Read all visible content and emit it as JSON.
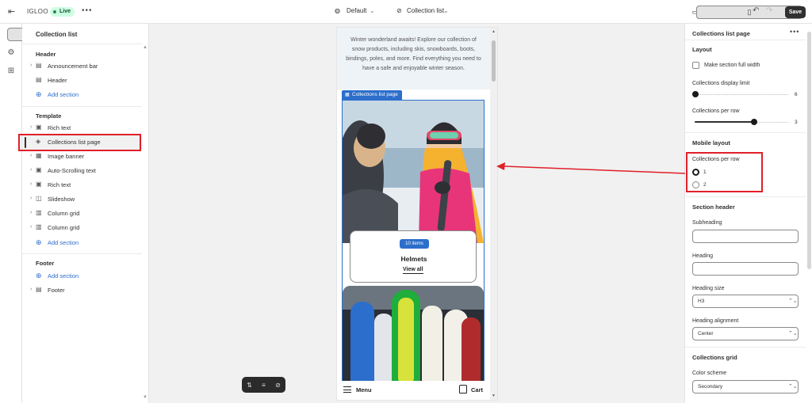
{
  "topbar": {
    "store_name": "IGLOO",
    "status_badge": "Live",
    "more": "•••",
    "theme_selector": "Default",
    "template_selector": "Collection list",
    "save_label": "Save"
  },
  "left_panel": {
    "title": "Collection list",
    "groups": {
      "header": "Header",
      "template": "Template",
      "footer": "Footer"
    },
    "header_items": [
      "Announcement bar",
      "Header"
    ],
    "template_items": [
      "Rich text",
      "Collections list page",
      "Image banner",
      "Auto-Scrolling text",
      "Rich text",
      "Slideshow",
      "Column grid",
      "Column grid"
    ],
    "footer_items": [
      "Footer"
    ],
    "add_section": "Add section"
  },
  "preview": {
    "intro_text": "Winter wonderland awaits! Explore our collection of snow products, including skis, snowboards, boots, bindings, poles, and more. Find everything you need to have a safe and enjoyable winter season.",
    "selected_section_tag": "Collections list page",
    "card": {
      "badge": "10 items",
      "title": "Helmets",
      "link": "View all"
    },
    "bottom_bar": {
      "menu": "Menu",
      "cart": "Cart"
    }
  },
  "right_panel": {
    "title": "Collections list page",
    "layout_heading": "Layout",
    "full_width_label": "Make section full width",
    "display_limit_label": "Collections display limit",
    "display_limit_value": "6",
    "per_row_label": "Collections per row",
    "per_row_value": "3",
    "mobile_layout_heading": "Mobile layout",
    "mobile_per_row_label": "Collections per row",
    "mobile_options": [
      "1",
      "2"
    ],
    "mobile_selected": "1",
    "section_header_heading": "Section header",
    "subheading_label": "Subheading",
    "subheading_value": "",
    "heading_label": "Heading",
    "heading_value": "",
    "heading_size_label": "Heading size",
    "heading_size_value": "H3",
    "heading_alignment_label": "Heading alignment",
    "heading_alignment_value": "Center",
    "collections_grid_heading": "Collections grid",
    "color_scheme_label": "Color scheme",
    "color_scheme_value": "Secondary"
  },
  "colors": {
    "accent": "#2c6ecb",
    "annotation": "#e0202a",
    "live_badge": "#cdfee1"
  }
}
